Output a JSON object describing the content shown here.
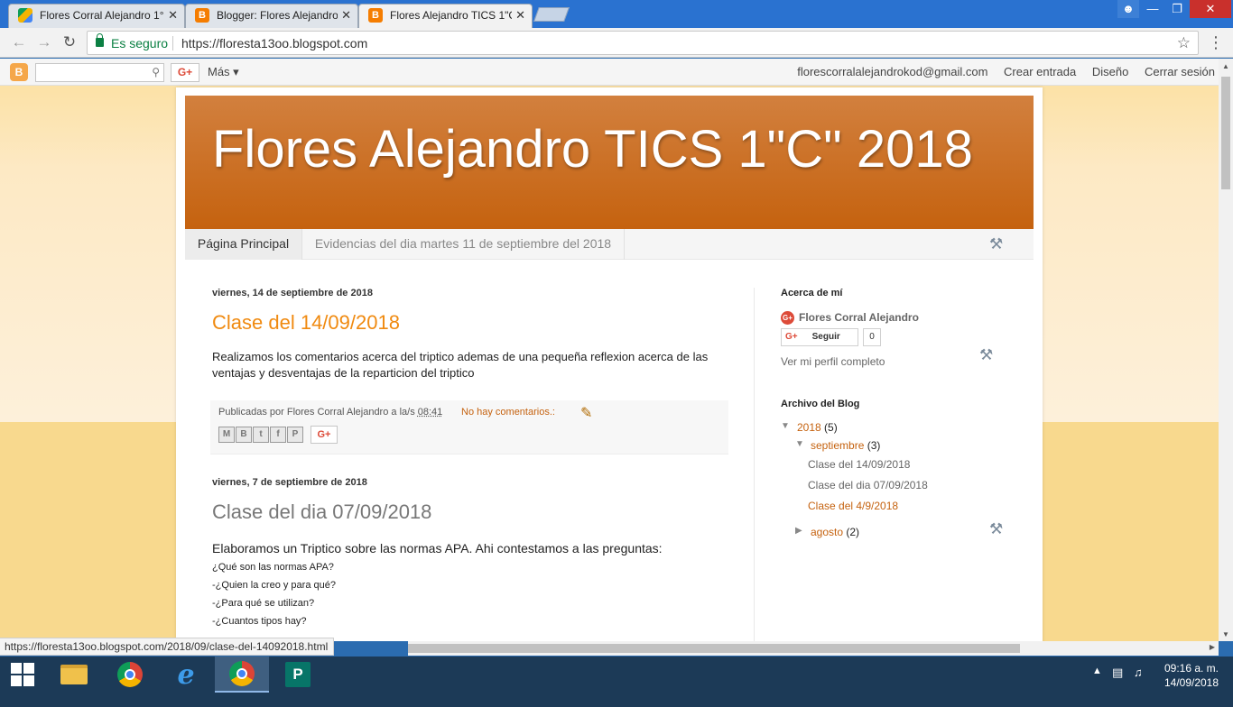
{
  "browser": {
    "tabs": [
      {
        "title": "Flores Corral Alejandro 1°",
        "icon": "google-drive-icon"
      },
      {
        "title": "Blogger: Flores Alejandro",
        "icon": "blogger-icon"
      },
      {
        "title": "Flores Alejandro TICS 1\"C",
        "icon": "blogger-icon"
      }
    ],
    "close_glyph": "✕",
    "secure_label": "Es seguro",
    "url": "https://floresta13oo.blogspot.com",
    "status_url": "https://floresta13oo.blogspot.com/2018/09/clase-del-14092018.html"
  },
  "blogger_nav": {
    "logo": "B",
    "gplus": "G+",
    "mas": "Más ▾",
    "email": "florescorralalejandrokod@gmail.com",
    "crear": "Crear entrada",
    "diseno": "Diseño",
    "cerrar": "Cerrar sesión"
  },
  "blog": {
    "title": "Flores Alejandro TICS 1\"C\" 2018",
    "tabs": [
      "Página Principal",
      "Evidencias del dia martes 11 de septiembre del 2018"
    ]
  },
  "posts": [
    {
      "date": "viernes, 14 de septiembre de 2018",
      "title": "Clase del 14/09/2018",
      "body": "Realizamos los comentarios acerca del triptico ademas de una pequeña reflexion acerca de las ventajas y desventajas de la reparticion del triptico",
      "publicadas_por": "Publicadas por",
      "author": "Flores Corral Alejandro",
      "a_las": "a la/s",
      "time": "08:41",
      "comments": "No hay comentarios.:",
      "share_gplus": "G+"
    },
    {
      "date": "viernes, 7 de septiembre de 2018",
      "title": "Clase del dia 07/09/2018",
      "body": "Elaboramos un Triptico sobre las normas APA. Ahi contestamos a las preguntas:",
      "lines": [
        "¿Qué son las normas APA?",
        "-¿Quien la creo y para qué?",
        "-¿Para qué se utilizan?",
        "-¿Cuantos tipos hay?"
      ]
    }
  ],
  "sidebar": {
    "about_title": "Acerca de mí",
    "profile_name": "Flores Corral Alejandro",
    "follow_g": "G+",
    "follow_label": "Seguir",
    "follow_count": "0",
    "full_profile": "Ver mi perfil completo",
    "archive_title": "Archivo del Blog",
    "year": "2018",
    "year_count": "(5)",
    "month": "septiembre",
    "month_count": "(3)",
    "month_posts": [
      "Clase del 14/09/2018",
      "Clase del dia 07/09/2018",
      "Clase del 4/9/2018"
    ],
    "other_month": "agosto",
    "other_month_count": "(2)"
  },
  "taskbar": {
    "time": "09:16 a. m.",
    "date": "14/09/2018"
  },
  "colors": {
    "header_top": "#d2803e",
    "header_bottom": "#c5620f",
    "link_orange": "#c5620f",
    "title_orange": "#f08a10"
  }
}
